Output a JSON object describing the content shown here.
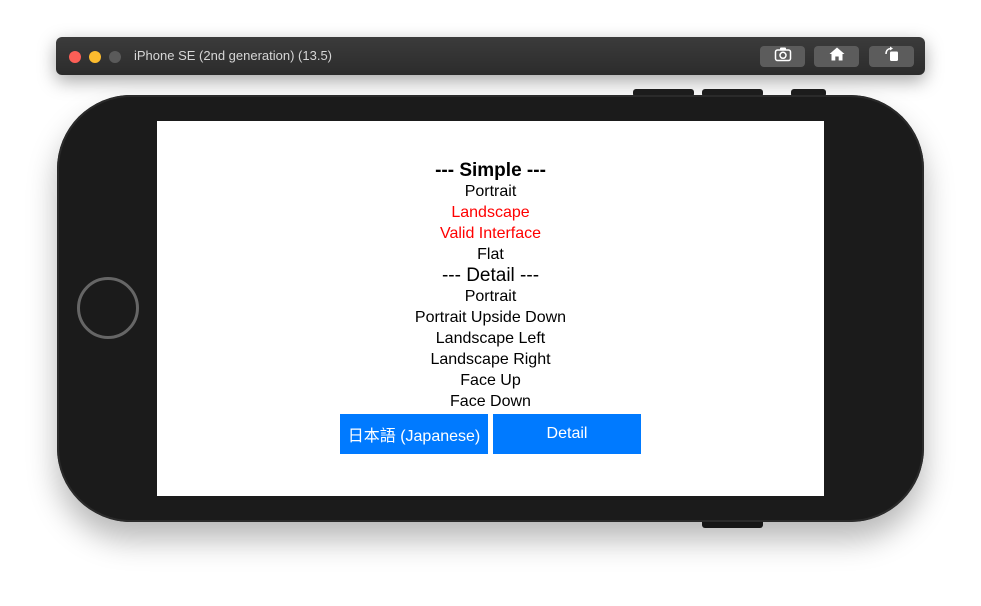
{
  "window": {
    "title": "iPhone SE (2nd generation) (13.5)",
    "toolbar_icons": [
      "camera-icon",
      "home-icon",
      "rotate-icon"
    ]
  },
  "app": {
    "simple_heading": "--- Simple ---",
    "simple_items": [
      {
        "label": "Portrait",
        "highlighted": false
      },
      {
        "label": "Landscape",
        "highlighted": true
      },
      {
        "label": "Valid Interface",
        "highlighted": true
      },
      {
        "label": "Flat",
        "highlighted": false
      }
    ],
    "detail_heading": "--- Detail ---",
    "detail_items": [
      "Portrait",
      "Portrait Upside Down",
      "Landscape Left",
      "Landscape Right",
      "Face Up",
      "Face Down"
    ],
    "japanese_button": "日本語 (Japanese)",
    "detail_button": "Detail"
  },
  "colors": {
    "highlight": "#ff0000",
    "button": "#007aff"
  }
}
